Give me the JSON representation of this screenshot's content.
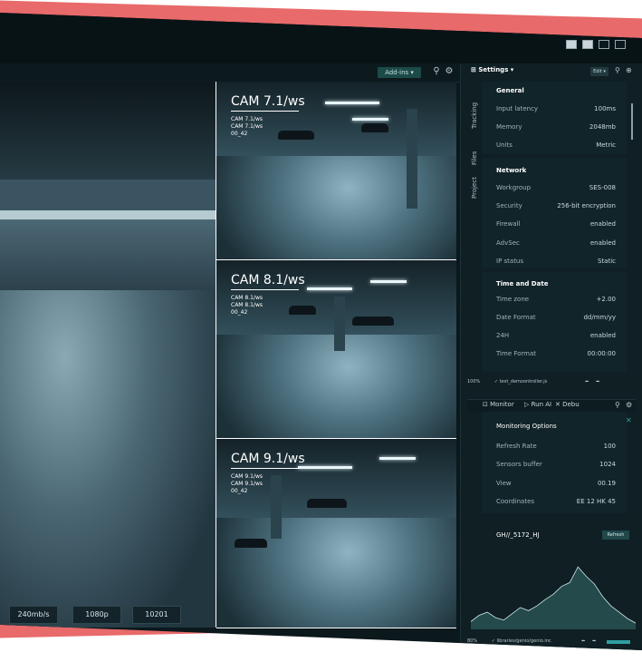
{
  "toolbar": {
    "addins_label": "Add-ins"
  },
  "main_camera": {
    "stats": [
      "240mb/s",
      "1080p",
      "10201"
    ]
  },
  "cameras": [
    {
      "title": "CAM 7.1/ws",
      "meta": [
        "CAM 7.1/ws",
        "CAM 7.1/ws",
        "00_42"
      ]
    },
    {
      "title": "CAM 8.1/ws",
      "meta": [
        "CAM 8.1/ws",
        "CAM 8.1/ws",
        "00_42"
      ]
    },
    {
      "title": "CAM 9.1/ws",
      "meta": [
        "CAM 9.1/ws",
        "CAM 9.1/ws",
        "00_42"
      ]
    }
  ],
  "settings": {
    "title": "Settings",
    "edit_label": "Edit",
    "tabs": [
      "Tracking",
      "Files",
      "Project"
    ],
    "general": {
      "title": "General",
      "rows": [
        {
          "label": "Input latency",
          "value": "100ms"
        },
        {
          "label": "Memory",
          "value": "2048mb"
        },
        {
          "label": "Units",
          "value": "Metric"
        }
      ]
    },
    "network": {
      "title": "Network",
      "rows": [
        {
          "label": "Workgroup",
          "value": "SES-008"
        },
        {
          "label": "Security",
          "value": "256-bit encryption"
        },
        {
          "label": "Firewall",
          "value": "enabled"
        },
        {
          "label": "AdvSec",
          "value": "enabled"
        },
        {
          "label": "IP status",
          "value": "Static"
        }
      ]
    },
    "time": {
      "title": "Time and Date",
      "rows": [
        {
          "label": "Time zone",
          "value": "+2.00"
        },
        {
          "label": "Date Format",
          "value": "dd/mm/yy"
        },
        {
          "label": "24H",
          "value": "enabled"
        },
        {
          "label": "Time Format",
          "value": "00:00:00"
        }
      ]
    },
    "status": {
      "zoom": "100%",
      "file": "test_demoontroller.js"
    }
  },
  "monitor": {
    "tabs": [
      "Monitor",
      "Run AI",
      "Debu"
    ],
    "options_title": "Monitoring Options",
    "rows": [
      {
        "label": "Refresh Rate",
        "value": "100"
      },
      {
        "label": "Sensors buffer",
        "value": "1024"
      },
      {
        "label": "View",
        "value": "00.19"
      },
      {
        "label": "Coordinates",
        "value": "EE 12 HK 45"
      }
    ],
    "chart_title": "GH//_5172_HJ",
    "refresh_label": "Refresh",
    "status": {
      "zoom": "80%",
      "file": "libraries/genio/genio.inc"
    }
  },
  "colors": {
    "accent": "#2f9fa0",
    "red_band": "#e86a6a",
    "panel": "#0f1f24"
  },
  "chart_data": {
    "type": "area",
    "x": [
      0,
      1,
      2,
      3,
      4,
      5,
      6,
      7,
      8,
      9,
      10,
      11,
      12,
      13,
      14,
      15,
      16,
      17,
      18,
      19,
      20
    ],
    "series": [
      {
        "values": [
          10,
          18,
          22,
          15,
          12,
          20,
          28,
          24,
          30,
          38,
          45,
          55,
          60,
          80,
          68,
          58,
          42,
          30,
          22,
          14,
          8
        ]
      }
    ],
    "ylim": [
      0,
      100
    ]
  }
}
